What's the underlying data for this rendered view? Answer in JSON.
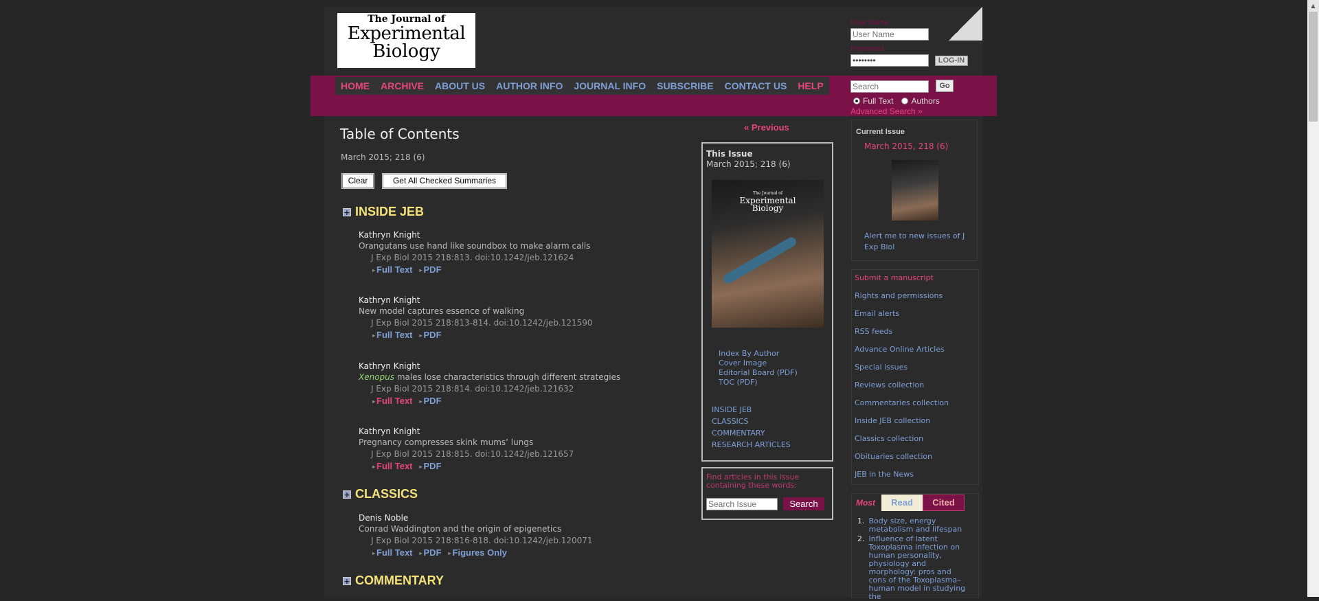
{
  "logo": {
    "line1": "The Journal of",
    "line2": "Experimental",
    "line3": "Biology"
  },
  "nav": [
    {
      "label": "HOME",
      "color": "pink"
    },
    {
      "label": "ARCHIVE",
      "color": "pink"
    },
    {
      "label": "ABOUT US",
      "color": "blue"
    },
    {
      "label": "AUTHOR INFO",
      "color": "blue"
    },
    {
      "label": "JOURNAL INFO",
      "color": "blue"
    },
    {
      "label": "SUBSCRIBE",
      "color": "blue"
    },
    {
      "label": "CONTACT US",
      "color": "blue"
    },
    {
      "label": "HELP",
      "color": "pink"
    }
  ],
  "login": {
    "username_label": "User Name",
    "username_placeholder": "User Name",
    "password_label": "Password",
    "password_value": "••••••••",
    "login_button": "LOG-IN"
  },
  "search": {
    "placeholder": "Search",
    "go_button": "Go",
    "opt_fulltext": "Full Text",
    "opt_authors": "Authors",
    "advanced": "Advanced Search »"
  },
  "main": {
    "title": "Table of Contents",
    "date": "March 2015; 218 (6)",
    "clear_button": "Clear",
    "get_summaries_button": "Get All Checked Summaries",
    "sections": [
      {
        "title": "INSIDE JEB"
      },
      {
        "title": "CLASSICS"
      },
      {
        "title": "COMMENTARY"
      }
    ],
    "articles": [
      {
        "author": "Kathryn Knight",
        "title": "Orangutans use hand like soundbox to make alarm calls",
        "citation": "J Exp Biol 2015 218:813. doi:10.1242/jeb.121624",
        "fulltext": "Full Text",
        "pdf": "PDF"
      },
      {
        "author": "Kathryn Knight",
        "title": "New model captures essence of walking",
        "citation": "J Exp Biol 2015 218:813-814. doi:10.1242/jeb.121590",
        "fulltext": "Full Text",
        "pdf": "PDF"
      },
      {
        "author": "Kathryn Knight",
        "title_italic": "Xenopus",
        "title_rest": " males lose characteristics through different strategies",
        "citation": "J Exp Biol 2015 218:814. doi:10.1242/jeb.121632",
        "fulltext": "Full Text",
        "pdf": "PDF"
      },
      {
        "author": "Kathryn Knight",
        "title": "Pregnancy compresses skink mums’ lungs",
        "citation": "J Exp Biol 2015 218:815. doi:10.1242/jeb.121657",
        "fulltext": "Full Text",
        "pdf": "PDF"
      },
      {
        "author": "Denis Noble",
        "title": "Conrad Waddington and the origin of epigenetics",
        "citation": "J Exp Biol 2015 218:816-818. doi:10.1242/jeb.120071",
        "fulltext": "Full Text",
        "pdf": "PDF",
        "figures": "Figures Only"
      }
    ]
  },
  "issue": {
    "previous": "« Previous",
    "box_title": "This Issue",
    "box_date": "March 2015; 218 (6)",
    "cover_line1": "The Journal of",
    "cover_line2": "Experimental",
    "cover_line3": "Biology",
    "links": [
      "Index By Author",
      "Cover Image",
      "Editorial Board (PDF)",
      "TOC (PDF)"
    ],
    "sections": [
      "INSIDE JEB",
      "CLASSICS",
      "COMMENTARY",
      "RESEARCH ARTICLES"
    ],
    "find_text": "Find articles in this issue containing these words:",
    "find_placeholder": "Search Issue",
    "find_button": "Search"
  },
  "sidebar": {
    "current_label": "Current Issue",
    "current_date": "March 2015, 218 (6)",
    "alert": "Alert me to new issues of J Exp Biol",
    "links": [
      {
        "label": "Submit a manuscript",
        "pink": true
      },
      {
        "label": "Rights and permissions"
      },
      {
        "label": "Email alerts"
      },
      {
        "label": "RSS feeds"
      },
      {
        "label": "Advance Online Articles"
      },
      {
        "label": "Special issues"
      },
      {
        "label": "Reviews collection"
      },
      {
        "label": "Commentaries collection"
      },
      {
        "label": "Inside JEB collection"
      },
      {
        "label": "Classics collection"
      },
      {
        "label": "Obituaries collection"
      },
      {
        "label": "JEB in the News"
      }
    ],
    "most_label": "Most",
    "tab_read": "Read",
    "tab_cited": "Cited",
    "most_items": [
      {
        "num": "1.",
        "title": "Body size, energy metabolism and lifespan"
      },
      {
        "num": "2.",
        "title": "Influence of latent Toxoplasma infection on human personality, physiology and morphology: pros and cons of the Toxoplasma–human model in studying the"
      }
    ]
  },
  "colors": {
    "accent": "#7a1247",
    "link_pink": "#e8457d",
    "link_blue": "#7d9fd6",
    "section": "#f4e27a"
  }
}
